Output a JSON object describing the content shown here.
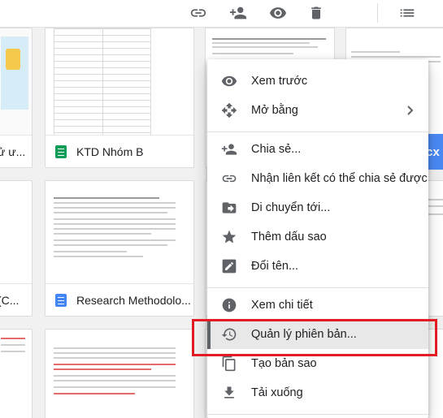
{
  "toolbar": {
    "icons": [
      "link-icon",
      "add-person-icon",
      "eye-icon",
      "trash-icon",
      "list-view-icon"
    ]
  },
  "files": {
    "partial_top_left": "ử ư...",
    "sheet_card": "KTD Nhóm B",
    "partial_mid_left": "(C...",
    "doc_card": "Research Methodolo..."
  },
  "fab": {
    "label": "cx"
  },
  "menu": {
    "items": [
      {
        "icon": "eye-icon",
        "label": "Xem trước"
      },
      {
        "icon": "move-arrows-icon",
        "label": "Mở bằng",
        "has_submenu": true
      },
      {
        "icon": "add-person-icon",
        "label": "Chia sẻ..."
      },
      {
        "icon": "link-icon",
        "label": "Nhận liên kết có thể chia sẻ được"
      },
      {
        "icon": "folder-move-icon",
        "label": "Di chuyển tới..."
      },
      {
        "icon": "star-icon",
        "label": "Thêm dấu sao"
      },
      {
        "icon": "pencil-icon",
        "label": "Đổi tên..."
      },
      {
        "icon": "info-icon",
        "label": "Xem chi tiết"
      },
      {
        "icon": "history-icon",
        "label": "Quản lý phiên bản..."
      },
      {
        "icon": "copy-icon",
        "label": "Tạo bản sao"
      },
      {
        "icon": "download-icon",
        "label": "Tải xuống"
      }
    ]
  },
  "colors": {
    "highlight_border": "#e31b23",
    "sheets_green": "#0f9d58",
    "docs_blue": "#4285f4",
    "icon_grey": "#5f6368"
  }
}
